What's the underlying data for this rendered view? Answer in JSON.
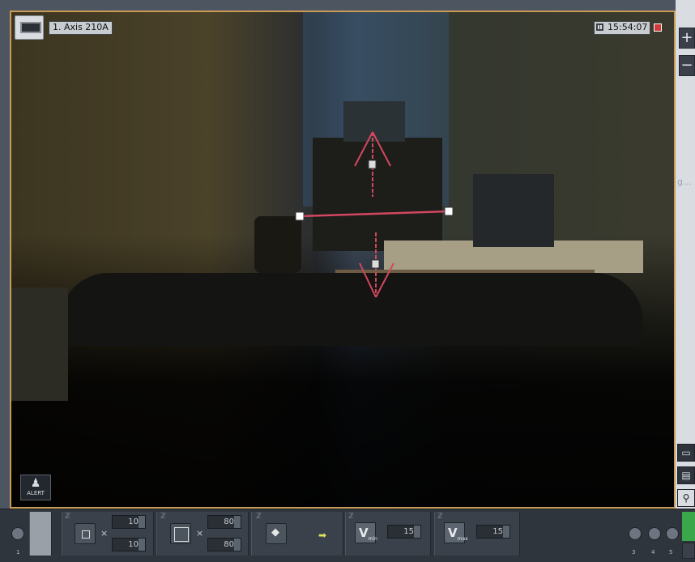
{
  "camera": {
    "label": "1. Axis 210A",
    "time": "15:54:07"
  },
  "alert_button": {
    "label": "ALERT"
  },
  "zoom": {
    "plus": "+",
    "minus": "−"
  },
  "background_text": "g...",
  "toolbar": {
    "size_min": {
      "width": "10",
      "height": "10",
      "times": "×"
    },
    "size_max": {
      "width": "80",
      "height": "80",
      "times": "×"
    },
    "vmin": {
      "label": "V",
      "sub": "min",
      "value": "15"
    },
    "vmax": {
      "label": "V",
      "sub": "max",
      "value": "15"
    },
    "left_page": "1",
    "right_pages": [
      "3",
      "4",
      "5"
    ]
  },
  "colors": {
    "frame": "#c99b56",
    "overlay_line": "#d1485f"
  }
}
